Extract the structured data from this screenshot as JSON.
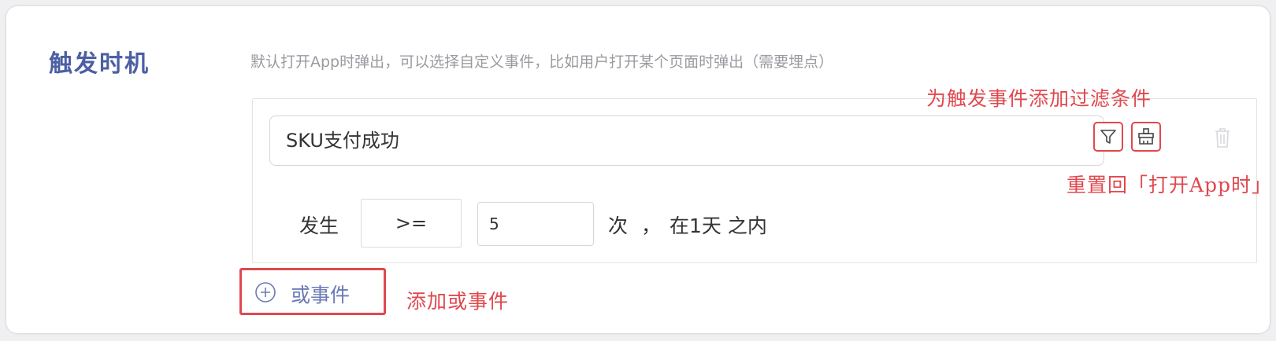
{
  "section": {
    "title": "触发时机",
    "description": "默认打开App时弹出，可以选择自定义事件，比如用户打开某个页面时弹出（需要埋点）"
  },
  "event": {
    "selected_event": "SKU支付成功",
    "filter_icon": "filter-icon",
    "reset_icon": "broom-icon",
    "delete_icon": "trash-icon"
  },
  "condition": {
    "occur_label": "发生",
    "operator": ">=",
    "count_value": "5",
    "times_label": "次",
    "comma": "，",
    "window_label": "在1天 之内"
  },
  "add_or_event": {
    "label": "或事件",
    "icon": "plus-circle-icon"
  },
  "annotations": {
    "filter_note": "为触发事件添加过滤条件",
    "reset_note": "重置回「打开App时」",
    "add_or_note": "添加或事件"
  },
  "colors": {
    "accent": "#4c5fa3",
    "annotation_red": "#e0484e",
    "muted_text": "#9a9aa0"
  }
}
